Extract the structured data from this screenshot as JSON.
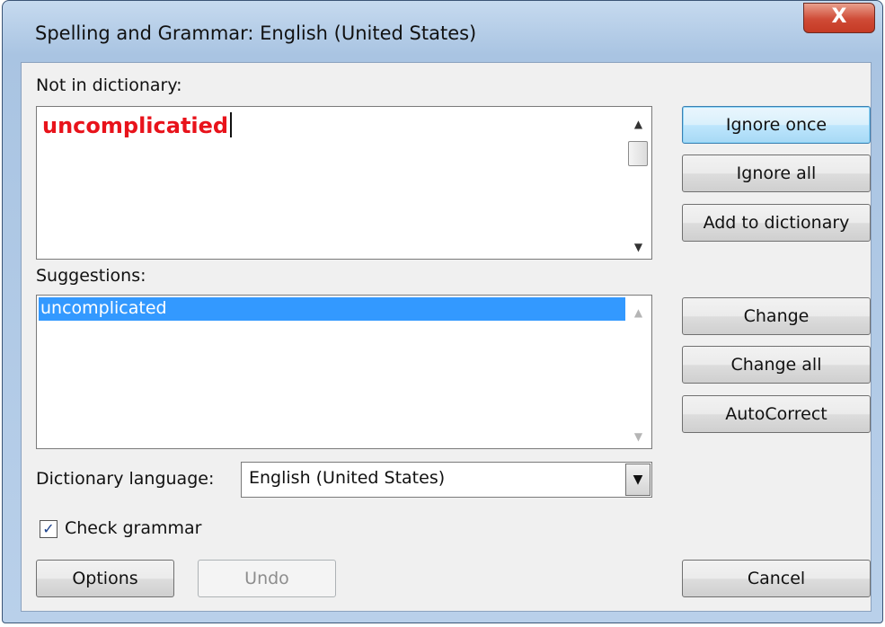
{
  "window": {
    "title": "Spelling and Grammar: English (United States)",
    "close_glyph": "X"
  },
  "not_in_dictionary": {
    "label": "Not in dictionary:",
    "word": "uncomplicatied"
  },
  "suggestions": {
    "label": "Suggestions:",
    "items": [
      "uncomplicated"
    ],
    "selected_index": 0
  },
  "dictionary_language": {
    "label": "Dictionary language:",
    "value": "English (United States)"
  },
  "check_grammar": {
    "label": "Check grammar",
    "checked": true
  },
  "buttons": {
    "ignore_once": "Ignore once",
    "ignore_all": "Ignore all",
    "add_to_dictionary": "Add to dictionary",
    "change": "Change",
    "change_all": "Change all",
    "autocorrect": "AutoCorrect",
    "options": "Options",
    "undo": "Undo",
    "cancel": "Cancel"
  },
  "colors": {
    "misspelled_text": "#e8131b",
    "selection": "#3399ff"
  }
}
